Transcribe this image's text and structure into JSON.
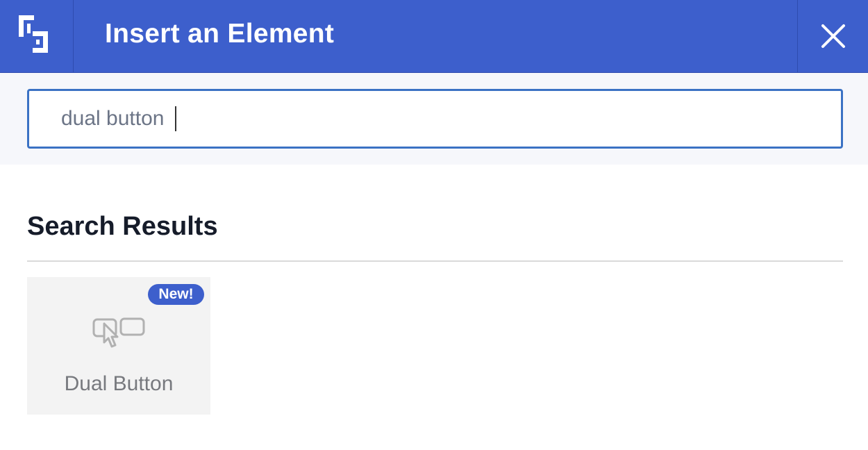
{
  "header": {
    "title": "Insert an Element",
    "logo_icon": "builder-logo-icon",
    "close_icon": "close-icon",
    "background": "#3d5fcc"
  },
  "search": {
    "value": "dual button",
    "placeholder": ""
  },
  "results": {
    "title": "Search Results",
    "items": [
      {
        "label": "Dual Button",
        "badge": "New!",
        "icon": "dual-button-icon"
      }
    ]
  }
}
